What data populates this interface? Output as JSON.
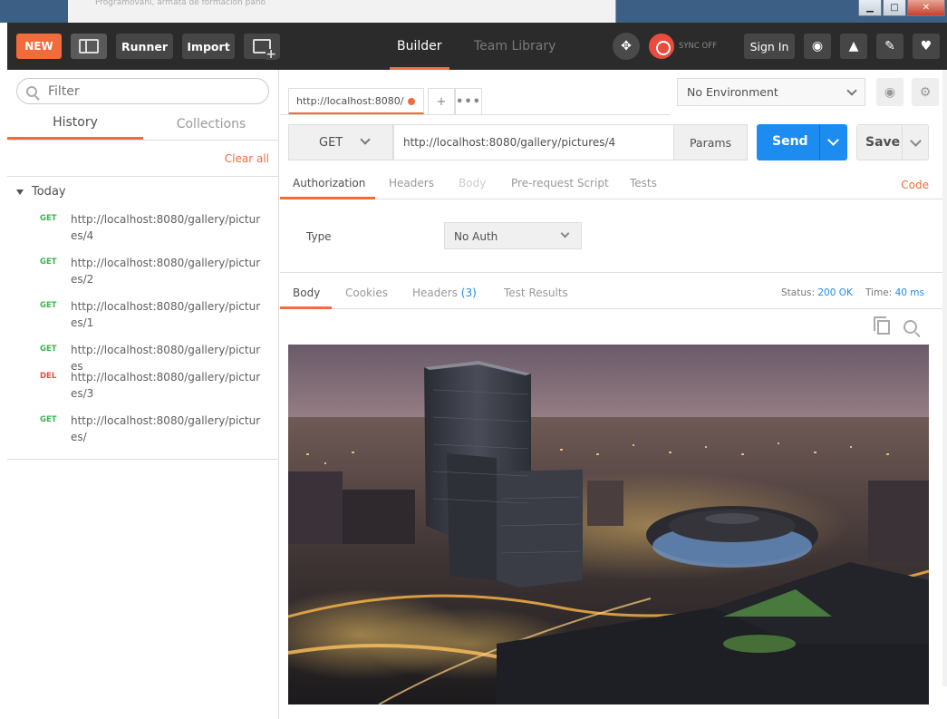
{
  "window": {
    "background_text": "Programování, armata de formación pano"
  },
  "toolbar": {
    "new_label": "NEW",
    "runner_label": "Runner",
    "import_label": "Import",
    "builder_label": "Builder",
    "team_library_label": "Team Library",
    "sync_label": "SYNC OFF",
    "signin_label": "Sign In"
  },
  "sidebar": {
    "filter_placeholder": "Filter",
    "tabs": {
      "history": "History",
      "collections": "Collections"
    },
    "clear_all": "Clear all",
    "group_label": "Today",
    "history": [
      {
        "method": "GET",
        "url": "http://localhost:8080/gallery/pictures/4"
      },
      {
        "method": "GET",
        "url": "http://localhost:8080/gallery/pictures/2"
      },
      {
        "method": "GET",
        "url": "http://localhost:8080/gallery/pictures/1"
      },
      {
        "method": "GET",
        "url": "http://localhost:8080/gallery/pictures"
      },
      {
        "method": "DEL",
        "url": "http://localhost:8080/gallery/pictures/3"
      },
      {
        "method": "GET",
        "url": "http://localhost:8080/gallery/pictures/"
      }
    ]
  },
  "request": {
    "tab_label": "http://localhost:8080/",
    "environment": "No Environment",
    "method": "GET",
    "url": "http://localhost:8080/gallery/pictures/4",
    "params_label": "Params",
    "send_label": "Send",
    "save_label": "Save",
    "subtabs": {
      "authorization": "Authorization",
      "headers": "Headers",
      "body": "Body",
      "prerequest": "Pre-request Script",
      "tests": "Tests",
      "code": "Code"
    },
    "auth_type_label": "Type",
    "auth_type_value": "No Auth"
  },
  "response": {
    "tabs": {
      "body": "Body",
      "cookies": "Cookies",
      "headers": "Headers",
      "headers_count": "(3)",
      "test_results": "Test Results"
    },
    "status_label": "Status:",
    "status_value": "200 OK",
    "time_label": "Time:",
    "time_value": "40 ms"
  },
  "colors": {
    "accent": "#f26b3a",
    "primary": "#1d8cf0",
    "toolbar_bg": "#2b2b2b",
    "get": "#39b54a",
    "del": "#e94b3c"
  },
  "icons": {
    "interceptor": "satellite-icon",
    "sync": "sync-icon",
    "globe": "globe-icon",
    "bell": "bell-icon",
    "settings": "wrench-icon",
    "heart": "heart-icon",
    "eye": "eye-icon",
    "gear": "gear-icon",
    "copy": "copy-icon",
    "search": "search-icon"
  }
}
